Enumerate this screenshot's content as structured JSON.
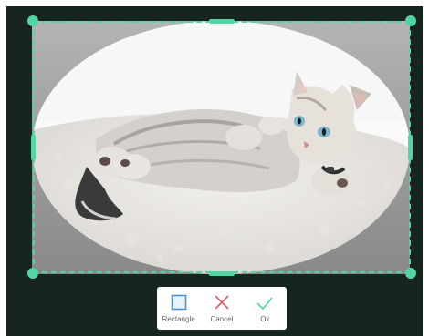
{
  "colors": {
    "background": "#17251f",
    "accent": "#4fd6a4",
    "rectangle_icon": "#4a90d9",
    "cancel_icon": "#e05a63",
    "ok_icon": "#4fd6a4"
  },
  "crop": {
    "shape": "ellipse",
    "handle_icon": "drag-handle-icon"
  },
  "toolbar": {
    "rectangle_label": "Rectangle",
    "cancel_label": "Cancel",
    "ok_label": "Ok",
    "rectangle_icon": "rectangle-icon",
    "cancel_icon": "close-icon",
    "ok_icon": "checkmark-icon"
  }
}
